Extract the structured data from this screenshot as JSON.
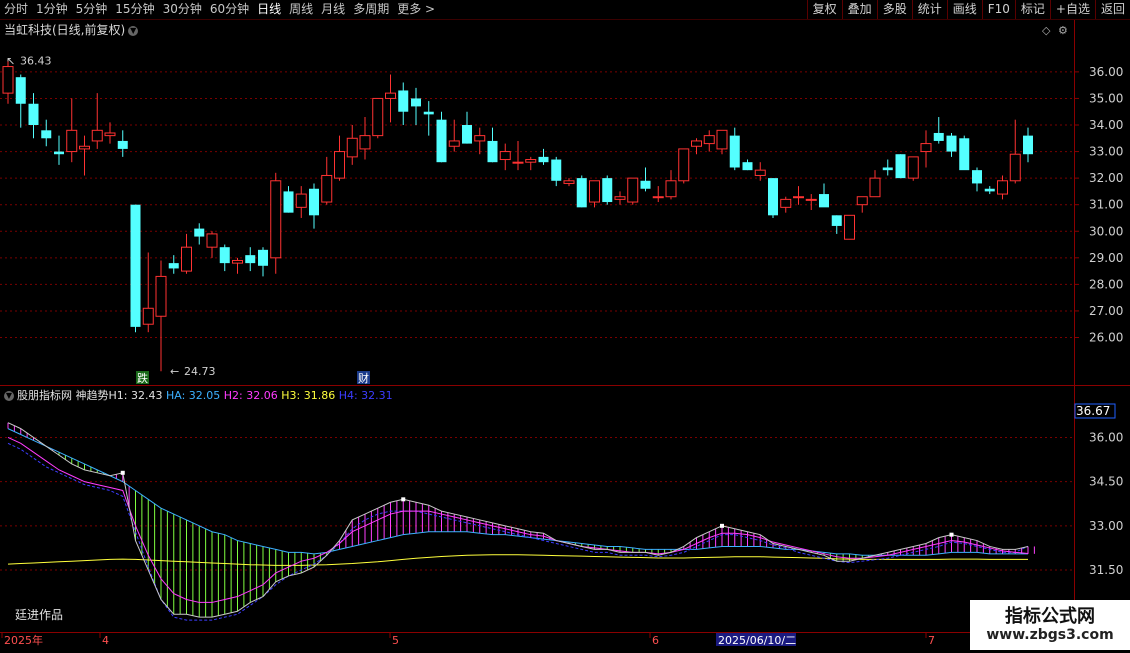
{
  "toolbar": {
    "periods": [
      "分时",
      "1分钟",
      "5分钟",
      "15分钟",
      "30分钟",
      "60分钟",
      "日线",
      "周线",
      "月线",
      "多周期",
      "更多 >"
    ],
    "active_period": "日线",
    "tools": [
      "复权",
      "叠加",
      "多股",
      "统计",
      "画线",
      "F10",
      "标记",
      "+自选",
      "返回"
    ]
  },
  "main_chart": {
    "title": "当虹科技(日线,前复权)",
    "high_marker": "36.43",
    "low_marker": "24.73",
    "badges": [
      "跌",
      "财"
    ],
    "up_color": "#ff3232",
    "down_color": "#54ffff"
  },
  "indicator": {
    "name": "股朋指标网",
    "subtitle": "神趋势",
    "h1": "H1: 32.43",
    "ha": "HA: 32.05",
    "h2": "H2: 32.06",
    "h3": "H3: 31.86",
    "h4": "H4: 32.31",
    "current_value": "36.67",
    "colors": {
      "h1": "#c8c8c8",
      "ha": "#3cb0ff",
      "h2": "#ff3cff",
      "h3": "#ffff3c",
      "h4": "#3c3cff"
    }
  },
  "time_axis": {
    "labels": [
      "2025年",
      "4",
      "5",
      "6",
      "7"
    ],
    "cursor_date": "2025/06/10/二"
  },
  "author": "廷进作品",
  "watermark": {
    "title": "指标公式网",
    "url": "www.zbgs3.com"
  },
  "chart_data": [
    {
      "type": "candlestick",
      "title": "当虹科技(日线,前复权)",
      "y_ticks": [
        "36.00",
        "35.00",
        "34.00",
        "33.00",
        "32.00",
        "31.00",
        "30.00",
        "29.00",
        "28.00",
        "27.00",
        "26.00"
      ],
      "ylim": [
        24.4,
        37.2
      ],
      "candles": [
        [
          35.2,
          36.43,
          34.8,
          36.2
        ],
        [
          35.8,
          35.9,
          33.9,
          34.8
        ],
        [
          34.8,
          35.2,
          33.5,
          34.0
        ],
        [
          33.8,
          34.2,
          33.2,
          33.5
        ],
        [
          33.0,
          33.6,
          32.5,
          32.9
        ],
        [
          33.0,
          35.0,
          32.6,
          33.8
        ],
        [
          33.1,
          33.6,
          32.1,
          33.2
        ],
        [
          33.4,
          35.2,
          33.1,
          33.8
        ],
        [
          33.6,
          34.1,
          33.3,
          33.7
        ],
        [
          33.4,
          33.8,
          32.8,
          33.1
        ],
        [
          31.0,
          31.0,
          26.2,
          26.4
        ],
        [
          26.5,
          29.2,
          26.2,
          27.1
        ],
        [
          26.8,
          28.9,
          24.73,
          28.3
        ],
        [
          28.8,
          29.1,
          28.4,
          28.6
        ],
        [
          28.5,
          29.9,
          28.4,
          29.4
        ],
        [
          30.1,
          30.3,
          29.5,
          29.8
        ],
        [
          29.4,
          30.0,
          29.0,
          29.9
        ],
        [
          29.4,
          29.5,
          28.5,
          28.8
        ],
        [
          28.8,
          29.0,
          28.4,
          28.9
        ],
        [
          29.1,
          29.4,
          28.5,
          28.8
        ],
        [
          29.3,
          29.4,
          28.3,
          28.7
        ],
        [
          29.0,
          32.2,
          28.4,
          31.9
        ],
        [
          31.5,
          31.7,
          30.7,
          30.7
        ],
        [
          30.9,
          31.7,
          30.5,
          31.4
        ],
        [
          31.6,
          31.8,
          30.1,
          30.6
        ],
        [
          31.1,
          32.8,
          31.0,
          32.1
        ],
        [
          32.0,
          33.6,
          31.9,
          33.0
        ],
        [
          32.8,
          34.0,
          32.5,
          33.5
        ],
        [
          33.1,
          34.3,
          32.7,
          33.6
        ],
        [
          33.6,
          35.0,
          33.5,
          35.0
        ],
        [
          35.0,
          35.9,
          34.1,
          35.2
        ],
        [
          35.3,
          35.6,
          34.0,
          34.5
        ],
        [
          35.0,
          35.4,
          34.0,
          34.7
        ],
        [
          34.5,
          34.9,
          33.6,
          34.4
        ],
        [
          34.2,
          34.5,
          32.6,
          32.6
        ],
        [
          33.2,
          34.2,
          33.0,
          33.4
        ],
        [
          34.0,
          34.5,
          33.3,
          33.3
        ],
        [
          33.4,
          33.9,
          32.9,
          33.6
        ],
        [
          33.4,
          33.9,
          32.6,
          32.6
        ],
        [
          32.7,
          33.3,
          32.3,
          33.0
        ],
        [
          32.6,
          33.4,
          32.3,
          32.6
        ],
        [
          32.6,
          32.8,
          32.3,
          32.7
        ],
        [
          32.8,
          33.1,
          32.5,
          32.6
        ],
        [
          32.7,
          32.8,
          31.7,
          31.9
        ],
        [
          31.8,
          32.0,
          31.7,
          31.9
        ],
        [
          32.0,
          32.1,
          30.9,
          30.9
        ],
        [
          31.1,
          31.9,
          30.9,
          31.9
        ],
        [
          32.0,
          32.1,
          31.0,
          31.1
        ],
        [
          31.2,
          31.5,
          31.0,
          31.3
        ],
        [
          31.1,
          32.0,
          31.0,
          32.0
        ],
        [
          31.9,
          32.4,
          31.5,
          31.6
        ],
        [
          31.3,
          31.7,
          31.1,
          31.3
        ],
        [
          31.3,
          32.3,
          31.2,
          31.9
        ],
        [
          31.9,
          33.1,
          31.8,
          33.1
        ],
        [
          33.2,
          33.5,
          32.9,
          33.4
        ],
        [
          33.3,
          33.8,
          33.0,
          33.6
        ],
        [
          33.1,
          33.8,
          32.9,
          33.8
        ],
        [
          33.6,
          33.9,
          32.3,
          32.4
        ],
        [
          32.6,
          32.7,
          32.3,
          32.3
        ],
        [
          32.1,
          32.6,
          31.9,
          32.3
        ],
        [
          32.0,
          32.0,
          30.5,
          30.6
        ],
        [
          30.9,
          31.3,
          30.7,
          31.2
        ],
        [
          31.3,
          31.7,
          31.0,
          31.3
        ],
        [
          31.2,
          31.4,
          30.8,
          31.2
        ],
        [
          31.4,
          31.8,
          31.0,
          30.9
        ],
        [
          30.6,
          30.6,
          29.9,
          30.2
        ],
        [
          29.7,
          30.6,
          29.7,
          30.6
        ],
        [
          31.0,
          31.3,
          30.7,
          31.3
        ],
        [
          31.3,
          32.3,
          31.3,
          32.0
        ],
        [
          32.4,
          32.7,
          32.1,
          32.3
        ],
        [
          32.9,
          32.9,
          32.0,
          32.0
        ],
        [
          32.0,
          32.8,
          31.9,
          32.8
        ],
        [
          33.0,
          33.8,
          32.4,
          33.3
        ],
        [
          33.7,
          34.3,
          33.3,
          33.4
        ],
        [
          33.6,
          33.7,
          32.8,
          33.0
        ],
        [
          33.5,
          33.6,
          32.4,
          32.3
        ],
        [
          32.3,
          32.4,
          31.5,
          31.8
        ],
        [
          31.6,
          31.7,
          31.4,
          31.5
        ],
        [
          31.4,
          32.1,
          31.2,
          31.9
        ],
        [
          31.9,
          34.2,
          31.8,
          32.9
        ],
        [
          33.6,
          33.9,
          32.6,
          32.9
        ]
      ]
    },
    {
      "type": "line",
      "title": "股朋指标网 神趋势",
      "y_ticks": [
        "36.00",
        "34.50",
        "33.00",
        "31.50"
      ],
      "ylim": [
        29.6,
        37.0
      ],
      "series": [
        {
          "name": "H1",
          "values": [
            36.5,
            36.3,
            36.0,
            35.7,
            35.4,
            35.1,
            34.9,
            34.8,
            34.7,
            34.8,
            32.5,
            31.5,
            30.5,
            30.0,
            30.0,
            29.9,
            29.9,
            30.0,
            30.1,
            30.4,
            30.6,
            31.1,
            31.3,
            31.4,
            31.6,
            32.0,
            32.5,
            33.2,
            33.4,
            33.6,
            33.8,
            33.9,
            33.8,
            33.7,
            33.5,
            33.4,
            33.3,
            33.2,
            33.1,
            33.0,
            32.9,
            32.8,
            32.75,
            32.5,
            32.4,
            32.3,
            32.2,
            32.2,
            32.1,
            32.1,
            32.1,
            32.0,
            32.1,
            32.3,
            32.6,
            32.8,
            33.0,
            32.9,
            32.8,
            32.7,
            32.4,
            32.3,
            32.2,
            32.1,
            32.0,
            31.8,
            31.8,
            31.9,
            32.0,
            32.1,
            32.2,
            32.3,
            32.4,
            32.6,
            32.7,
            32.6,
            32.5,
            32.3,
            32.2,
            32.2,
            32.3
          ]
        },
        {
          "name": "HA",
          "values": [
            36.3,
            36.1,
            35.9,
            35.7,
            35.5,
            35.3,
            35.1,
            34.9,
            34.7,
            34.5,
            34.2,
            33.9,
            33.6,
            33.4,
            33.2,
            33.0,
            32.8,
            32.7,
            32.5,
            32.4,
            32.3,
            32.2,
            32.1,
            32.1,
            32.05,
            32.1,
            32.2,
            32.3,
            32.4,
            32.5,
            32.6,
            32.7,
            32.75,
            32.8,
            32.8,
            32.8,
            32.8,
            32.75,
            32.7,
            32.7,
            32.65,
            32.6,
            32.55,
            32.5,
            32.45,
            32.4,
            32.35,
            32.3,
            32.3,
            32.25,
            32.2,
            32.2,
            32.2,
            32.2,
            32.2,
            32.25,
            32.3,
            32.3,
            32.3,
            32.3,
            32.25,
            32.2,
            32.2,
            32.15,
            32.1,
            32.05,
            32.05,
            32.0,
            32.0,
            32.0,
            32.0,
            32.0,
            32.0,
            32.05,
            32.1,
            32.1,
            32.1,
            32.05,
            32.05,
            32.05,
            32.05
          ]
        },
        {
          "name": "H2",
          "values": [
            36.0,
            35.8,
            35.5,
            35.2,
            34.9,
            34.7,
            34.5,
            34.4,
            34.3,
            34.2,
            33.0,
            32.0,
            31.2,
            30.7,
            30.5,
            30.4,
            30.4,
            30.5,
            30.6,
            30.8,
            31.0,
            31.4,
            31.6,
            31.8,
            31.9,
            32.1,
            32.4,
            32.8,
            33.0,
            33.2,
            33.4,
            33.5,
            33.5,
            33.5,
            33.4,
            33.3,
            33.2,
            33.1,
            33.0,
            32.9,
            32.8,
            32.7,
            32.65,
            32.5,
            32.4,
            32.3,
            32.25,
            32.2,
            32.15,
            32.1,
            32.1,
            32.05,
            32.1,
            32.2,
            32.4,
            32.6,
            32.75,
            32.75,
            32.7,
            32.6,
            32.45,
            32.35,
            32.25,
            32.15,
            32.05,
            31.95,
            31.9,
            31.9,
            31.95,
            32.0,
            32.1,
            32.2,
            32.3,
            32.4,
            32.5,
            32.45,
            32.35,
            32.25,
            32.15,
            32.1,
            32.06
          ]
        },
        {
          "name": "H3",
          "values": [
            31.7,
            31.72,
            31.74,
            31.76,
            31.78,
            31.8,
            31.82,
            31.84,
            31.86,
            31.87,
            31.86,
            31.84,
            31.82,
            31.8,
            31.78,
            31.76,
            31.74,
            31.72,
            31.7,
            31.68,
            31.67,
            31.66,
            31.66,
            31.66,
            31.67,
            31.68,
            31.7,
            31.72,
            31.75,
            31.78,
            31.82,
            31.86,
            31.9,
            31.93,
            31.96,
            31.98,
            32.0,
            32.01,
            32.02,
            32.02,
            32.02,
            32.01,
            32.0,
            31.99,
            31.98,
            31.97,
            31.96,
            31.95,
            31.94,
            31.93,
            31.92,
            31.91,
            31.91,
            31.91,
            31.92,
            31.93,
            31.94,
            31.95,
            31.95,
            31.95,
            31.94,
            31.93,
            31.92,
            31.91,
            31.9,
            31.88,
            31.87,
            31.86,
            31.86,
            31.86,
            31.86,
            31.86,
            31.86,
            31.86,
            31.87,
            31.87,
            31.87,
            31.86,
            31.86,
            31.86,
            31.86
          ]
        },
        {
          "name": "H4",
          "values": [
            35.8,
            35.6,
            35.3,
            35.0,
            34.8,
            34.6,
            34.4,
            34.3,
            34.2,
            34.0,
            32.8,
            31.6,
            30.5,
            29.9,
            29.8,
            29.8,
            29.8,
            29.9,
            30.0,
            30.3,
            30.6,
            31.0,
            31.3,
            31.5,
            31.7,
            32.0,
            32.4,
            32.9,
            33.2,
            33.4,
            33.5,
            33.5,
            33.5,
            33.4,
            33.3,
            33.2,
            33.1,
            33.0,
            32.9,
            32.8,
            32.7,
            32.6,
            32.5,
            32.4,
            32.3,
            32.2,
            32.1,
            32.1,
            32.0,
            32.0,
            32.0,
            31.95,
            32.0,
            32.1,
            32.3,
            32.5,
            32.7,
            32.7,
            32.6,
            32.5,
            32.35,
            32.25,
            32.1,
            32.0,
            31.9,
            31.8,
            31.75,
            31.8,
            31.85,
            31.9,
            32.0,
            32.1,
            32.2,
            32.3,
            32.45,
            32.4,
            32.3,
            32.2,
            32.1,
            32.1,
            32.31
          ]
        }
      ]
    }
  ]
}
